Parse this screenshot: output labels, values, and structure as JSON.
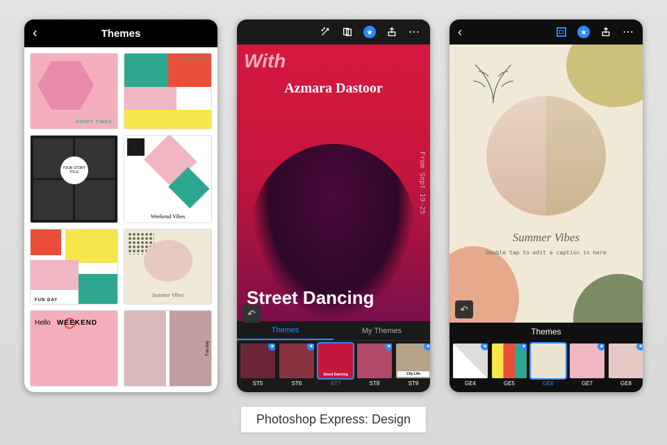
{
  "caption": "Photoshop Express: Design",
  "phone1": {
    "header_title": "Themes",
    "templates": {
      "t1_label": "HAPPY TIMES",
      "t2_label": "weekend vibes",
      "t3_label": "YOUR STORY TITLE",
      "t4_label": "Weekend Vibes",
      "t5_label": "FUN DAY",
      "t6_label": "Summer Vibes",
      "t7a": "Hello",
      "t7b": "WEEKEND",
      "t8_side": "Fun day"
    }
  },
  "phone2": {
    "canvas": {
      "with": "With",
      "artist": "Azmara Dastoor",
      "date_range": "From Sept 19-25",
      "main_title": "Street Dancing"
    },
    "tabs": {
      "themes": "Themes",
      "my_themes": "My Themes"
    },
    "thumbs": [
      {
        "id": "ST5",
        "caption": ""
      },
      {
        "id": "ST6",
        "caption": ""
      },
      {
        "id": "ST7",
        "caption": "Street Dancing"
      },
      {
        "id": "ST8",
        "caption": ""
      },
      {
        "id": "ST9",
        "caption": "City Life"
      }
    ]
  },
  "phone3": {
    "canvas": {
      "title": "Summer Vibes",
      "hint": "Double tap to edit a caption in here"
    },
    "strip_label": "Themes",
    "thumbs": [
      {
        "id": "GE4"
      },
      {
        "id": "GE5"
      },
      {
        "id": "GE6"
      },
      {
        "id": "GE7"
      },
      {
        "id": "GE8"
      }
    ]
  }
}
